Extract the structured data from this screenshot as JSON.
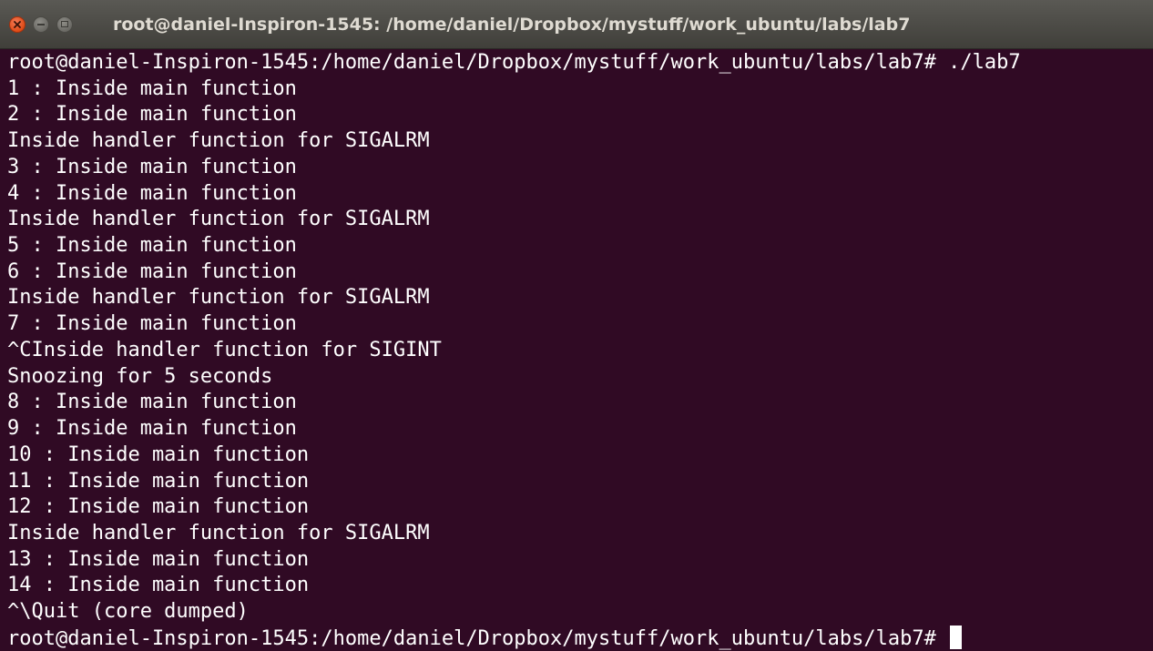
{
  "window": {
    "title": "root@daniel-Inspiron-1545: /home/daniel/Dropbox/mystuff/work_ubuntu/labs/lab7",
    "buttons": {
      "close_icon": "close-icon",
      "minimize_icon": "minimize-icon",
      "maximize_icon": "maximize-icon"
    }
  },
  "colors": {
    "terminal_background": "#300a24",
    "terminal_text": "#ffffff",
    "close_button": "#df4b16"
  },
  "terminal": {
    "lines": [
      "root@daniel-Inspiron-1545:/home/daniel/Dropbox/mystuff/work_ubuntu/labs/lab7# ./lab7",
      "1 : Inside main function",
      "2 : Inside main function",
      "Inside handler function for SIGALRM",
      "3 : Inside main function",
      "4 : Inside main function",
      "Inside handler function for SIGALRM",
      "5 : Inside main function",
      "6 : Inside main function",
      "Inside handler function for SIGALRM",
      "7 : Inside main function",
      "^CInside handler function for SIGINT",
      "Snoozing for 5 seconds",
      "8 : Inside main function",
      "9 : Inside main function",
      "10 : Inside main function",
      "11 : Inside main function",
      "12 : Inside main function",
      "Inside handler function for SIGALRM",
      "13 : Inside main function",
      "14 : Inside main function",
      "^\\Quit (core dumped)"
    ],
    "prompt": "root@daniel-Inspiron-1545:/home/daniel/Dropbox/mystuff/work_ubuntu/labs/lab7# "
  }
}
